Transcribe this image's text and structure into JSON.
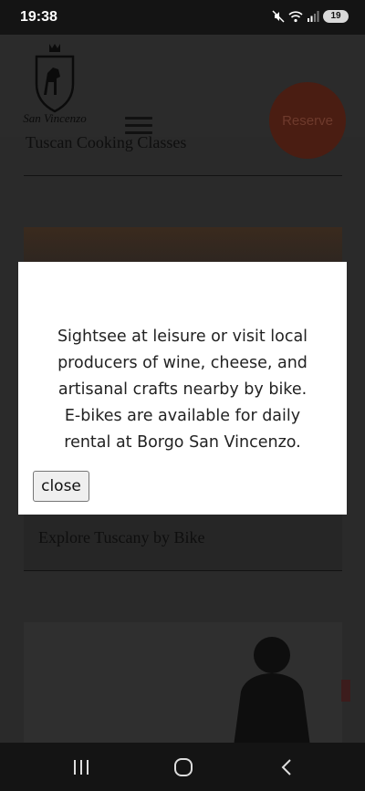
{
  "status_bar": {
    "time": "19:38",
    "battery_level": "19",
    "icons": [
      "mute-icon",
      "wifi-icon",
      "signal-icon",
      "battery-icon"
    ]
  },
  "header": {
    "logo_alt": "San Vincenzo",
    "menu_icon": "hamburger-menu-icon",
    "reserve_label": "Reserve"
  },
  "content": {
    "card1_title": "Tuscan Cooking Classes",
    "card2_title": "Explore Tuscany by Bike"
  },
  "modal": {
    "text": "Sightsee at leisure or visit local producers of wine, cheese, and artisanal crafts nearby by bike. E-bikes are available for daily rental at Borgo San Vincenzo.",
    "close_label": "close"
  },
  "nav_bar": {
    "icons": [
      "recent-apps-icon",
      "home-icon",
      "back-icon"
    ]
  },
  "colors": {
    "overlay_bg": "#2a2a2a",
    "modal_bg": "#ffffff",
    "reserve_bg": "#4a1d12"
  }
}
